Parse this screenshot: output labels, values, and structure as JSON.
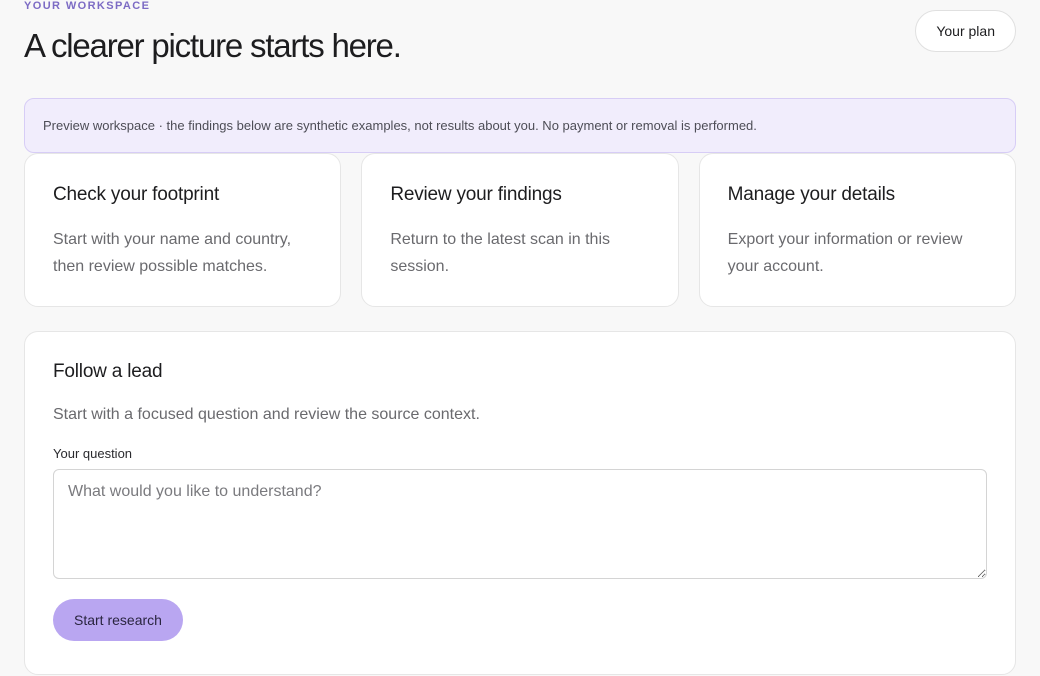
{
  "header": {
    "eyebrow": "YOUR WORKSPACE",
    "title": "A clearer picture starts here.",
    "plan_button": "Your plan"
  },
  "notice": {
    "text": "Preview workspace · the findings below are synthetic examples, not results about you. No payment or removal is performed."
  },
  "cards": [
    {
      "title": "Check your footprint",
      "description": "Start with your name and country, then review possible matches."
    },
    {
      "title": "Review your findings",
      "description": "Return to the latest scan in this session."
    },
    {
      "title": "Manage your details",
      "description": "Export your information or review your account."
    }
  ],
  "lead": {
    "title": "Follow a lead",
    "description": "Start with a focused question and review the source context.",
    "field_label": "Your question",
    "field_placeholder": "What would you like to understand?",
    "field_value": "",
    "submit_label": "Start research"
  },
  "colors": {
    "accent": "#b9a6f1",
    "eyebrow": "#7c6bc4",
    "notice_background": "#f1edfc",
    "notice_border": "#d7cdf6",
    "page_background": "#f8f8f8"
  }
}
